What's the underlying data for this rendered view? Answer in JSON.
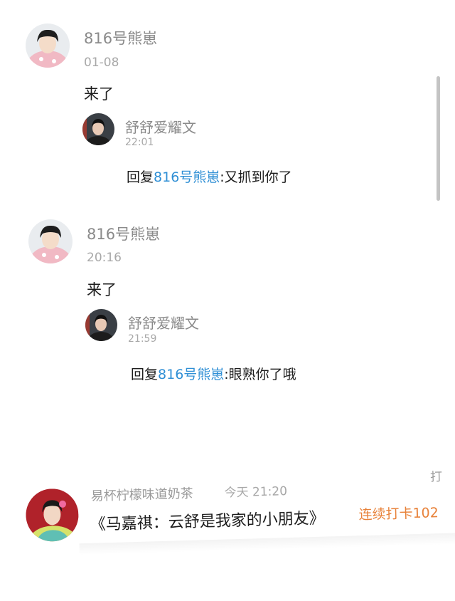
{
  "comments": [
    {
      "user": "816号熊崽",
      "time": "01-08",
      "text": "来了",
      "reply": {
        "user": "舒舒爱耀文",
        "time": "22:01",
        "prefix": "回复",
        "mention": "816号熊崽",
        "body": ":又抓到你了"
      }
    },
    {
      "user": "816号熊崽",
      "time": "20:16",
      "text": "来了",
      "reply": {
        "user": "舒舒爱耀文",
        "time": "21:59",
        "prefix": "回复",
        "mention": "816号熊崽",
        "body": ":眼熟你了哦"
      }
    }
  ],
  "bottom_card": {
    "user": "易杯柠檬味道奶茶",
    "time": "今天 21:20",
    "title": "《马嘉祺：云舒是我家的小朋友》",
    "streak": "连续打卡102",
    "corner": "打"
  },
  "colors": {
    "mention": "#2f8fd5",
    "streak": "#e8823a",
    "meta": "#8a8a8a"
  }
}
